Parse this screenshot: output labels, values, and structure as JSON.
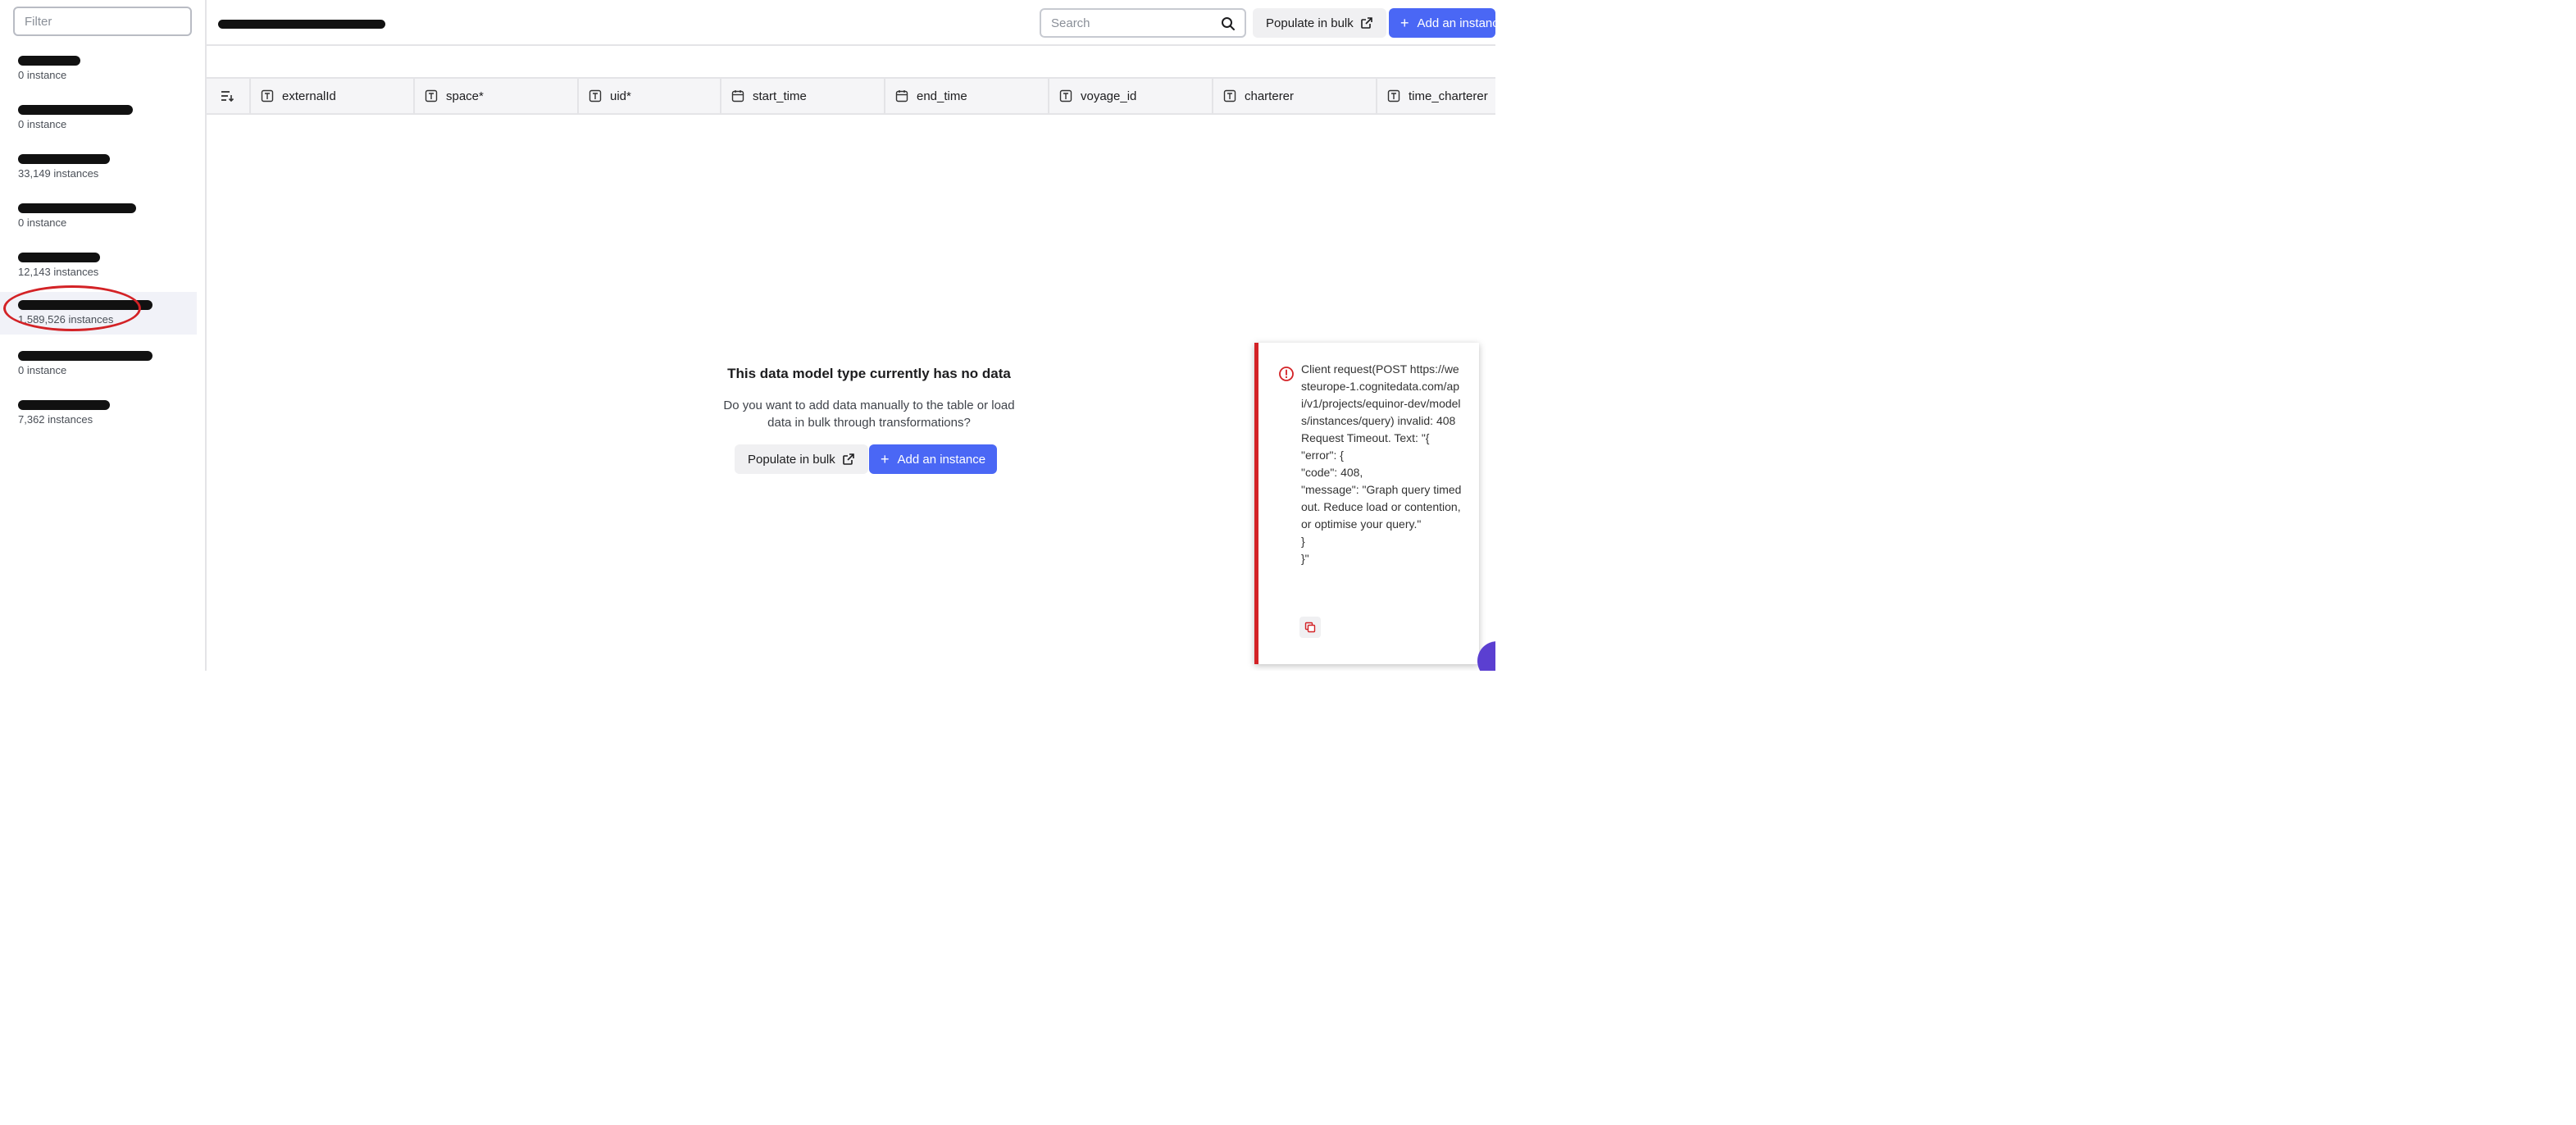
{
  "sidebar": {
    "filter_placeholder": "Filter",
    "items": [
      {
        "count": "0 instance"
      },
      {
        "count": "0 instance"
      },
      {
        "count": "33,149 instances"
      },
      {
        "count": "0 instance"
      },
      {
        "count": "12,143 instances"
      },
      {
        "count": "1,589,526 instances",
        "selected": true
      },
      {
        "count": "0 instance"
      },
      {
        "count": "7,362 instances"
      }
    ]
  },
  "header": {
    "search_placeholder": "Search",
    "populate_label": "Populate in bulk",
    "add_label": "Add an instance"
  },
  "table": {
    "columns": [
      "externalId",
      "space*",
      "uid*",
      "start_time",
      "end_time",
      "voyage_id",
      "charterer",
      "time_charterer"
    ]
  },
  "empty_state": {
    "title": "This data model type currently has no data",
    "description": "Do you want to add data manually to the table or load data in bulk through transformations?",
    "populate_label": "Populate in bulk",
    "add_label": "Add an instance"
  },
  "toast": {
    "message": "Client request(POST https://westeurope-1.cognitedata.com/api/v1/projects/equinor-dev/models/instances/query) invalid: 408 Request Timeout. Text: \"{\n\"error\": {\n\"code\": 408,\n\"message\": \"Graph query timed out. Reduce load or contention, or optimise your query.\"\n}\n}\""
  },
  "colors": {
    "primary": "#4a67f5",
    "error": "#d32226",
    "secondary_bg": "#f0f0f2"
  }
}
